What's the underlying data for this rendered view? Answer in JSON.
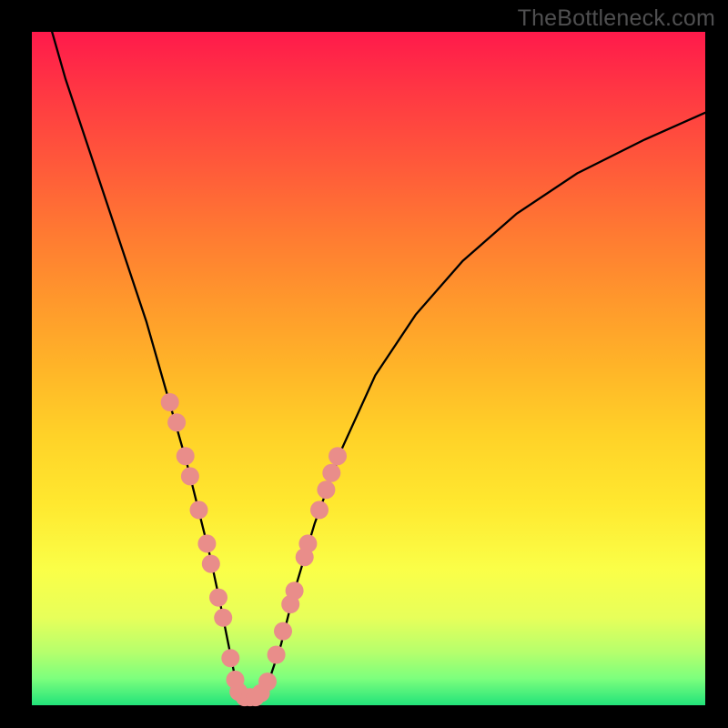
{
  "watermark": "TheBottleneck.com",
  "chart_data": {
    "type": "line",
    "title": "",
    "xlabel": "",
    "ylabel": "",
    "xlim": [
      0,
      100
    ],
    "ylim": [
      0,
      100
    ],
    "grid": false,
    "legend": false,
    "series": [
      {
        "name": "curve",
        "color": "#000000",
        "x": [
          3,
          5,
          8,
          11,
          14,
          17,
          19,
          21,
          23,
          25,
          26.5,
          28,
          29,
          30,
          31,
          32,
          33.5,
          35,
          37,
          39,
          42,
          46,
          51,
          57,
          64,
          72,
          81,
          91,
          100
        ],
        "y": [
          100,
          93,
          84,
          75,
          66,
          57,
          50,
          43,
          36,
          28,
          22,
          15,
          10,
          5,
          1.2,
          1.2,
          1.2,
          3,
          9,
          17,
          27,
          38,
          49,
          58,
          66,
          73,
          79,
          84,
          88
        ]
      }
    ],
    "markers": {
      "name": "highlight-dots",
      "color": "#e98d8a",
      "radius": 10,
      "points": [
        {
          "x": 20.5,
          "y": 45
        },
        {
          "x": 21.5,
          "y": 42
        },
        {
          "x": 22.8,
          "y": 37
        },
        {
          "x": 23.5,
          "y": 34
        },
        {
          "x": 24.8,
          "y": 29
        },
        {
          "x": 26.0,
          "y": 24
        },
        {
          "x": 26.6,
          "y": 21
        },
        {
          "x": 27.7,
          "y": 16
        },
        {
          "x": 28.4,
          "y": 13
        },
        {
          "x": 29.5,
          "y": 7
        },
        {
          "x": 30.2,
          "y": 3.8
        },
        {
          "x": 30.7,
          "y": 2.0
        },
        {
          "x": 31.6,
          "y": 1.2
        },
        {
          "x": 32.4,
          "y": 1.2
        },
        {
          "x": 33.2,
          "y": 1.2
        },
        {
          "x": 34.0,
          "y": 1.8
        },
        {
          "x": 35.0,
          "y": 3.5
        },
        {
          "x": 36.3,
          "y": 7.5
        },
        {
          "x": 37.3,
          "y": 11
        },
        {
          "x": 38.4,
          "y": 15
        },
        {
          "x": 39.0,
          "y": 17
        },
        {
          "x": 40.5,
          "y": 22
        },
        {
          "x": 41.0,
          "y": 24
        },
        {
          "x": 42.7,
          "y": 29
        },
        {
          "x": 43.7,
          "y": 32
        },
        {
          "x": 44.5,
          "y": 34.5
        },
        {
          "x": 45.4,
          "y": 37
        }
      ]
    },
    "background_gradient": {
      "orientation": "vertical",
      "stops": [
        {
          "pos": 0,
          "color": "#ff1a4b"
        },
        {
          "pos": 0.5,
          "color": "#ffb528"
        },
        {
          "pos": 0.82,
          "color": "#f7ff4c"
        },
        {
          "pos": 1.0,
          "color": "#22e37a"
        }
      ]
    }
  }
}
